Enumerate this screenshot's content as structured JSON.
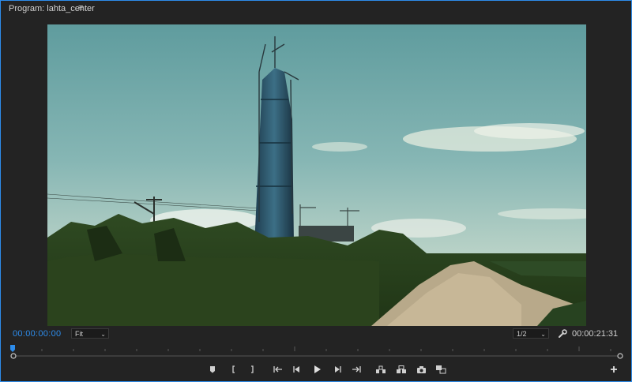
{
  "panel": {
    "title": "Program: lahta_center",
    "menu_glyph": "≡"
  },
  "controls": {
    "current_timecode": "00:00:00:00",
    "zoom_select": "Fit",
    "resolution_select": "1/2",
    "duration_timecode": "00:00:21:31"
  },
  "colors": {
    "accent": "#2d8ceb",
    "panel_bg": "#232323"
  },
  "buttons": [
    {
      "name": "add-marker-button",
      "icon": "marker-icon"
    },
    {
      "name": "mark-in-button",
      "icon": "mark-in-icon"
    },
    {
      "name": "mark-out-button",
      "icon": "mark-out-icon"
    },
    {
      "name": "go-to-in-button",
      "icon": "go-to-in-icon"
    },
    {
      "name": "step-back-button",
      "icon": "step-back-icon"
    },
    {
      "name": "play-button",
      "icon": "play-icon"
    },
    {
      "name": "step-forward-button",
      "icon": "step-forward-icon"
    },
    {
      "name": "go-to-out-button",
      "icon": "go-to-out-icon"
    },
    {
      "name": "lift-button",
      "icon": "lift-icon"
    },
    {
      "name": "extract-button",
      "icon": "extract-icon"
    },
    {
      "name": "export-frame-button",
      "icon": "camera-icon"
    },
    {
      "name": "comparison-view-button",
      "icon": "compare-icon"
    },
    {
      "name": "button-editor-button",
      "icon": "plus-icon"
    }
  ]
}
